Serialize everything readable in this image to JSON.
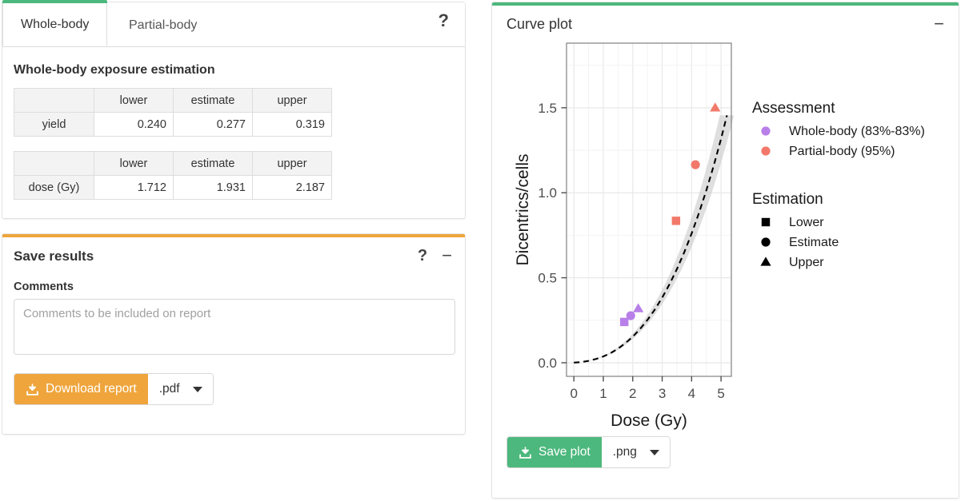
{
  "results_panel": {
    "tabs": [
      {
        "label": "Whole-body",
        "active": true
      },
      {
        "label": "Partial-body",
        "active": false
      }
    ],
    "help_icon": "?",
    "section_title": "Whole-body exposure estimation",
    "tables": [
      {
        "name": "yield-table",
        "columns": [
          "",
          "lower",
          "estimate",
          "upper"
        ],
        "rows": [
          {
            "label": "yield",
            "values": [
              "0.240",
              "0.277",
              "0.319"
            ]
          }
        ]
      },
      {
        "name": "dose-table",
        "columns": [
          "",
          "lower",
          "estimate",
          "upper"
        ],
        "rows": [
          {
            "label": "dose (Gy)",
            "values": [
              "1.712",
              "1.931",
              "2.187"
            ]
          }
        ]
      }
    ]
  },
  "save_panel": {
    "accent_color": "#efa53c",
    "title": "Save results",
    "help_icon": "?",
    "minimize_icon": "−",
    "comments_label": "Comments",
    "comments_value": "",
    "comments_placeholder": "Comments to be included on report",
    "download_button": "Download report",
    "download_icon": "download-icon",
    "format_value": ".pdf"
  },
  "plot_panel": {
    "accent_color": "#4cb87d",
    "title": "Curve plot",
    "minimize_icon": "−",
    "save_button": "Save plot",
    "save_icon": "download-icon",
    "format_value": ".png"
  },
  "chart_data": {
    "type": "line",
    "title": "",
    "xlabel": "Dose (Gy)",
    "ylabel": "Dicentrics/cells",
    "xlim": [
      -0.25,
      5.35
    ],
    "ylim": [
      -0.08,
      1.88
    ],
    "xticks": [
      0,
      1,
      2,
      3,
      4,
      5
    ],
    "xticklabels": [
      "0",
      "1",
      "2",
      "3",
      "4",
      "5"
    ],
    "yticks": [
      0.0,
      0.5,
      1.0,
      1.5
    ],
    "yticklabels": [
      "0.0",
      "0.5",
      "1.0",
      "1.5"
    ],
    "grid": true,
    "legend_position": "right",
    "curve": {
      "name": "Calibration curve",
      "style": "dashed",
      "color": "#000000",
      "band_color": "#cccccc",
      "points": [
        {
          "x": 0.0,
          "y": 0.001
        },
        {
          "x": 0.25,
          "y": 0.004
        },
        {
          "x": 0.5,
          "y": 0.011
        },
        {
          "x": 0.75,
          "y": 0.022
        },
        {
          "x": 1.0,
          "y": 0.037
        },
        {
          "x": 1.25,
          "y": 0.057
        },
        {
          "x": 1.5,
          "y": 0.083
        },
        {
          "x": 1.75,
          "y": 0.115
        },
        {
          "x": 2.0,
          "y": 0.153
        },
        {
          "x": 2.25,
          "y": 0.199
        },
        {
          "x": 2.5,
          "y": 0.252
        },
        {
          "x": 2.75,
          "y": 0.313
        },
        {
          "x": 3.0,
          "y": 0.383
        },
        {
          "x": 3.25,
          "y": 0.462
        },
        {
          "x": 3.5,
          "y": 0.551
        },
        {
          "x": 3.75,
          "y": 0.65
        },
        {
          "x": 4.0,
          "y": 0.76
        },
        {
          "x": 4.25,
          "y": 0.881
        },
        {
          "x": 4.5,
          "y": 1.014
        },
        {
          "x": 4.75,
          "y": 1.159
        },
        {
          "x": 5.0,
          "y": 1.317
        },
        {
          "x": 5.2,
          "y": 1.455
        }
      ],
      "band_half_width_frac": 0.085
    },
    "series": [
      {
        "name": "Whole-body (83%-83%)",
        "color": "#b87fe8",
        "points": [
          {
            "label": "Lower",
            "marker": "square",
            "x": 1.712,
            "y": 0.24
          },
          {
            "label": "Estimate",
            "marker": "circle",
            "x": 1.931,
            "y": 0.277
          },
          {
            "label": "Upper",
            "marker": "triangle",
            "x": 2.187,
            "y": 0.319
          }
        ]
      },
      {
        "name": "Partial-body (95%)",
        "color": "#f2796a",
        "points": [
          {
            "label": "Lower",
            "marker": "square",
            "x": 3.47,
            "y": 0.835
          },
          {
            "label": "Estimate",
            "marker": "circle",
            "x": 4.13,
            "y": 1.165
          },
          {
            "label": "Upper",
            "marker": "triangle",
            "x": 4.8,
            "y": 1.5
          }
        ]
      }
    ],
    "legends": [
      {
        "title": "Assessment",
        "entries": [
          {
            "label": "Whole-body (83%-83%)",
            "marker": "circle",
            "color": "#b87fe8"
          },
          {
            "label": "Partial-body (95%)",
            "marker": "circle",
            "color": "#f2796a"
          }
        ]
      },
      {
        "title": "Estimation",
        "entries": [
          {
            "label": "Lower",
            "marker": "square",
            "color": "#000000"
          },
          {
            "label": "Estimate",
            "marker": "circle",
            "color": "#000000"
          },
          {
            "label": "Upper",
            "marker": "triangle",
            "color": "#000000"
          }
        ]
      }
    ]
  }
}
